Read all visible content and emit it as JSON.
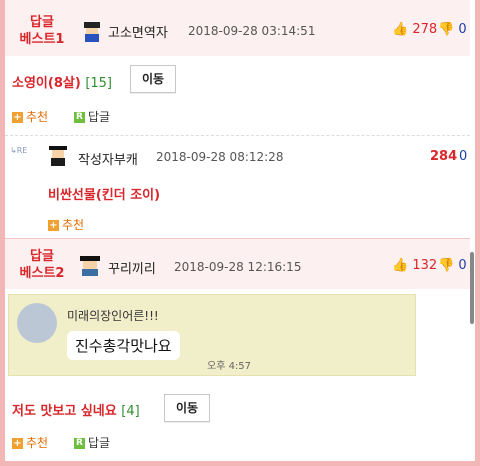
{
  "posts": [
    {
      "badge_line1": "답글",
      "badge_line2": "베스트1",
      "nickname": "고소면역자",
      "datetime": "2018-09-28 03:14:51",
      "upvotes": "278",
      "downvotes": "0",
      "title": "소영이(8살)",
      "reply_count": "[15]",
      "move_label": "이동",
      "recommend_label": "추천",
      "reply_label": "답글"
    },
    {
      "re_label": "RE",
      "nickname": "작성자부캐",
      "datetime": "2018-09-28 08:12:28",
      "upvotes": "284",
      "downvotes": "0",
      "title": "비싼선물(킨더 조이)",
      "recommend_label": "추천"
    },
    {
      "badge_line1": "답글",
      "badge_line2": "베스트2",
      "nickname": "꾸리끼리",
      "datetime": "2018-09-28 12:16:15",
      "upvotes": "132",
      "downvotes": "0",
      "image": {
        "sender_name": "미래의장인어른!!!",
        "message": "진수총각맛나요",
        "time": "오후 4:57"
      },
      "title": "저도 맛보고 싶네요",
      "reply_count": "[4]",
      "move_label": "이동",
      "recommend_label": "추천",
      "reply_label": "답글"
    }
  ],
  "colors": {
    "accent_red": "#d9262b",
    "down_blue": "#1e3ea8",
    "border_pink": "#f2b6b6",
    "best_band": "#fdf0f0"
  }
}
